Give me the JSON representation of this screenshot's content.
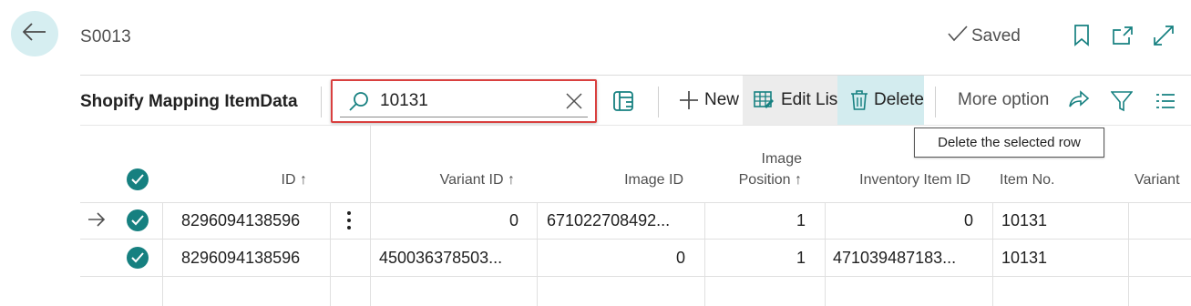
{
  "header": {
    "title": "S0013",
    "saved_label": "Saved"
  },
  "action_bar": {
    "list_title": "Shopify Mapping ItemData",
    "search_value": "10131",
    "new_label": "New",
    "edit_label": "Edit Lis",
    "delete_label": "Delete",
    "more_options_label": "More option",
    "tooltip": "Delete the selected row"
  },
  "table": {
    "columns": [
      "ID",
      "Variant ID",
      "Image ID",
      "Image Position",
      "Inventory Item ID",
      "Item No.",
      "Variant"
    ],
    "column_header_line1": "Image",
    "column_header_line2": "Position",
    "sort_arrow": "↑",
    "rows": [
      {
        "id": "8296094138596",
        "variant_id": "0",
        "image_id": "671022708492...",
        "image_position": "1",
        "inventory_item_id": "0",
        "item_no": "10131"
      },
      {
        "id": "8296094138596",
        "variant_id": "450036378503...",
        "image_id": "0",
        "image_position": "1",
        "inventory_item_id": "471039487183...",
        "item_no": "10131"
      }
    ]
  },
  "colors": {
    "accent": "#168080",
    "highlight": "#d9403f",
    "back_bg": "#d6eef1"
  }
}
